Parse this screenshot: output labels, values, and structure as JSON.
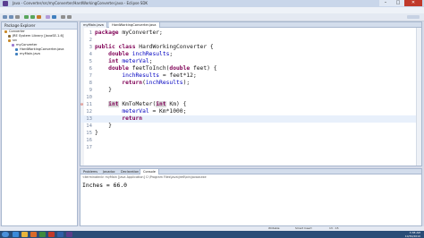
{
  "window": {
    "title": "Java - Converter/src/myConverter/HardWorkingConverter.java - Eclipse SDK",
    "min_label": "–",
    "max_label": "□",
    "close_label": "✕"
  },
  "menu": [
    "File",
    "Edit",
    "Source",
    "Refactor",
    "Navigate",
    "Search",
    "Project",
    "Run",
    "Window",
    "Help"
  ],
  "package_explorer": {
    "title": "Package Explorer",
    "items": [
      {
        "label": "Converter",
        "indent": 0,
        "icon_color": "#c98a2b"
      },
      {
        "label": "JRE System Library [JavaSE-1.6]",
        "indent": 1,
        "icon_color": "#8a6d3b"
      },
      {
        "label": "src",
        "indent": 1,
        "icon_color": "#c98a2b"
      },
      {
        "label": "myConverter",
        "indent": 2,
        "icon_color": "#9b7bd1"
      },
      {
        "label": "HardWorkingConverter.java",
        "indent": 3,
        "icon_color": "#3f7fbf"
      },
      {
        "label": "myMain.java",
        "indent": 3,
        "icon_color": "#3f7fbf"
      }
    ]
  },
  "editor": {
    "tabs": [
      {
        "label": "myMain.java"
      },
      {
        "label": "HardWorkingConverter.java",
        "active": true
      }
    ],
    "lines": [
      {
        "num": "1",
        "text": "package myConverter;"
      },
      {
        "num": "2",
        "text": ""
      },
      {
        "num": "3",
        "text": "public class HardWorkingConverter {"
      },
      {
        "num": "4",
        "text": "    double inchResults;"
      },
      {
        "num": "5",
        "text": "    int meterVal;"
      },
      {
        "num": "6",
        "text": "    double feetToInch(double feet) {"
      },
      {
        "num": "7",
        "text": "        inchResults = feet*12;"
      },
      {
        "num": "8",
        "text": "        return(inchResults);"
      },
      {
        "num": "9",
        "text": "    }"
      },
      {
        "num": "10",
        "text": ""
      },
      {
        "num": "11",
        "text": "    int KmToMeter(int Km) {"
      },
      {
        "num": "12",
        "text": "        meterVal = Km*1000;"
      },
      {
        "num": "13",
        "text": "        return"
      },
      {
        "num": "14",
        "text": "    }"
      },
      {
        "num": "15",
        "text": "}"
      },
      {
        "num": "16",
        "text": ""
      },
      {
        "num": "17",
        "text": ""
      }
    ]
  },
  "bottom_panel": {
    "tabs": [
      "Problems",
      "Javadoc",
      "Declaration",
      "Console"
    ],
    "console_info": "<terminated> myMain [Java Application] C:\\Program Files\\Java\\jre6\\bin\\javaw.exe",
    "output": "Inches = 66.0"
  },
  "status": {
    "writable": "Writable",
    "insert_mode": "Smart Insert",
    "position": "13 : 15"
  },
  "taskbar": {
    "time": "3:38 AM",
    "date": "10/30/2010"
  }
}
